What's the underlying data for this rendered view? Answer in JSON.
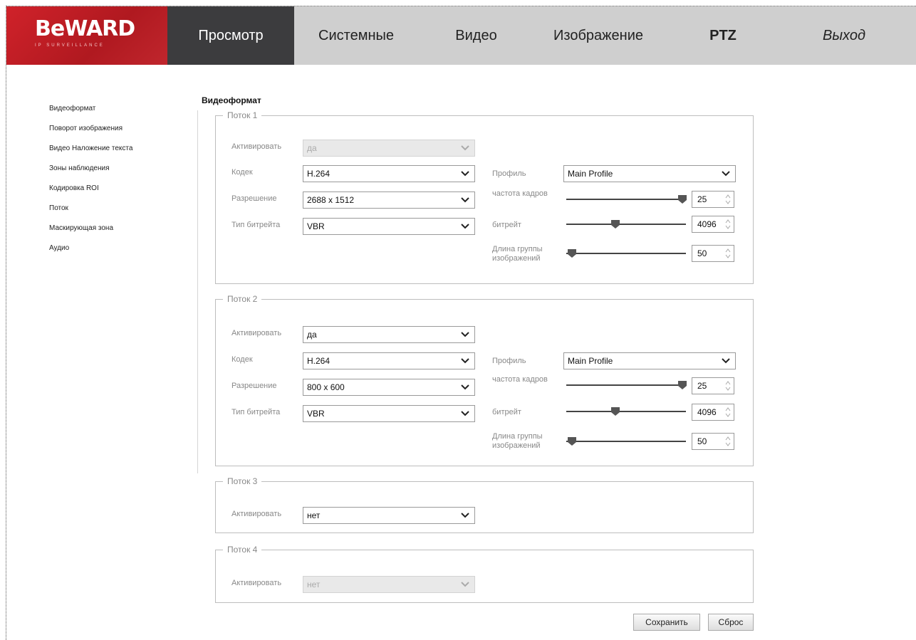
{
  "brand": {
    "name": "BeWARD",
    "tagline": "IP SURVEILLANCE"
  },
  "nav": [
    {
      "label": "Просмотр"
    },
    {
      "label": "Системные"
    },
    {
      "label": "Видео"
    },
    {
      "label": "Изображение"
    },
    {
      "label": "PTZ"
    },
    {
      "label": "Выход"
    }
  ],
  "sidebar": {
    "items": [
      {
        "label": "Видеоформат"
      },
      {
        "label": "Поворот изображения"
      },
      {
        "label": "Видео Наложение текста"
      },
      {
        "label": "Зоны наблюдения"
      },
      {
        "label": "Кодировка ROI"
      },
      {
        "label": "Поток"
      },
      {
        "label": "Маскирующая зона"
      },
      {
        "label": "Аудио"
      }
    ]
  },
  "page_title": "Видеоформат",
  "labels": {
    "activate": "Активировать",
    "codec": "Кодек",
    "resolution": "Разрешение",
    "bitrate_type": "Тип битрейта",
    "profile": "Профиль",
    "framerate": "частота кадров",
    "bitrate": "битрейт",
    "gop": "Длина группы изображений"
  },
  "streams": [
    {
      "title": "Поток 1",
      "activate": "да",
      "codec": "H.264",
      "resolution": "2688 x 1512",
      "bitrate_type": "VBR",
      "profile": "Main Profile",
      "framerate": "25",
      "bitrate": "4096",
      "gop": "50",
      "framerate_level": 0.97,
      "bitrate_level": 0.41,
      "gop_level": 0.05
    },
    {
      "title": "Поток 2",
      "activate": "да",
      "codec": "H.264",
      "resolution": "800 x 600",
      "bitrate_type": "VBR",
      "profile": "Main Profile",
      "framerate": "25",
      "bitrate": "4096",
      "gop": "50",
      "framerate_level": 0.97,
      "bitrate_level": 0.41,
      "gop_level": 0.05
    },
    {
      "title": "Поток 3",
      "activate": "нет"
    },
    {
      "title": "Поток 4",
      "activate": "нет"
    }
  ],
  "buttons": {
    "save": "Сохранить",
    "reset": "Сброс"
  },
  "colors": {
    "brand_red": "#c8232b",
    "active_tab": "#3c3c3e",
    "nav_bg": "#cfcfcf"
  }
}
